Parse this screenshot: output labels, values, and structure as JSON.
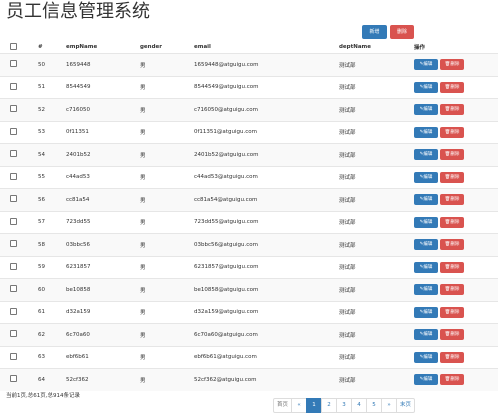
{
  "page": {
    "title": "员工信息管理系统"
  },
  "toolbar": {
    "add_label": "新增",
    "delete_label": "删除"
  },
  "table": {
    "headers": [
      "",
      "#",
      "empName",
      "gender",
      "email",
      "deptName",
      "操作"
    ],
    "edit_label": "✎编辑",
    "delete_label": "🗑删除",
    "rows": [
      {
        "id": "50",
        "name": "1659448",
        "gender": "男",
        "email": "1659448@atguigu.com",
        "dept": "测试部"
      },
      {
        "id": "51",
        "name": "8544549",
        "gender": "男",
        "email": "8544549@atguigu.com",
        "dept": "测试部"
      },
      {
        "id": "52",
        "name": "c716050",
        "gender": "男",
        "email": "c716050@atguigu.com",
        "dept": "测试部"
      },
      {
        "id": "53",
        "name": "0f11351",
        "gender": "男",
        "email": "0f11351@atguigu.com",
        "dept": "测试部"
      },
      {
        "id": "54",
        "name": "2401b52",
        "gender": "男",
        "email": "2401b52@atguigu.com",
        "dept": "测试部"
      },
      {
        "id": "55",
        "name": "c44ad53",
        "gender": "男",
        "email": "c44ad53@atguigu.com",
        "dept": "测试部"
      },
      {
        "id": "56",
        "name": "cc81a54",
        "gender": "男",
        "email": "cc81a54@atguigu.com",
        "dept": "测试部"
      },
      {
        "id": "57",
        "name": "723dd55",
        "gender": "男",
        "email": "723dd55@atguigu.com",
        "dept": "测试部"
      },
      {
        "id": "58",
        "name": "03bbc56",
        "gender": "男",
        "email": "03bbc56@atguigu.com",
        "dept": "测试部"
      },
      {
        "id": "59",
        "name": "6231857",
        "gender": "男",
        "email": "6231857@atguigu.com",
        "dept": "测试部"
      },
      {
        "id": "60",
        "name": "be10858",
        "gender": "男",
        "email": "be10858@atguigu.com",
        "dept": "测试部"
      },
      {
        "id": "61",
        "name": "d32a159",
        "gender": "男",
        "email": "d32a159@atguigu.com",
        "dept": "测试部"
      },
      {
        "id": "62",
        "name": "6c70a60",
        "gender": "男",
        "email": "6c70a60@atguigu.com",
        "dept": "测试部"
      },
      {
        "id": "63",
        "name": "ebf6b61",
        "gender": "男",
        "email": "ebf6b61@atguigu.com",
        "dept": "测试部"
      },
      {
        "id": "64",
        "name": "52cf362",
        "gender": "男",
        "email": "52cf362@atguigu.com",
        "dept": "测试部"
      }
    ]
  },
  "footer": {
    "info": "当前1页,总61页,总914条记录"
  },
  "pagination": {
    "first": "首页",
    "prev": "«",
    "pages": [
      "1",
      "2",
      "3",
      "4",
      "5"
    ],
    "active_page": "1",
    "next": "»",
    "last": "末页"
  },
  "colors": {
    "primary": "#337ab7",
    "danger": "#d9534f"
  }
}
